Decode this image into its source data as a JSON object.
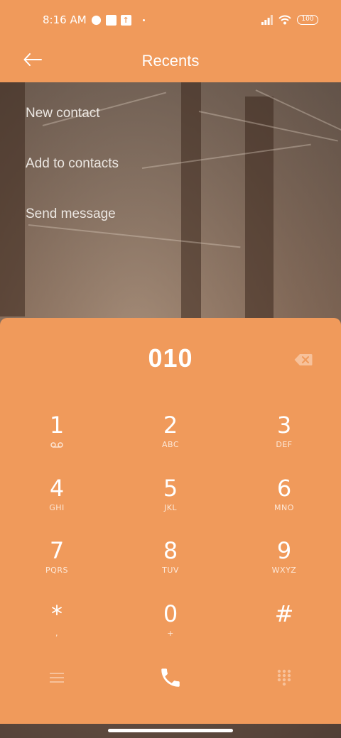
{
  "status_bar": {
    "time": "8:16 AM",
    "battery": "100",
    "icons": [
      "moon-icon",
      "square-notification-icon",
      "upload-icon",
      "dot-icon",
      "signal-icon",
      "wifi-icon",
      "battery-icon"
    ]
  },
  "app_bar": {
    "title": "Recents",
    "back_icon": "arrow-left-icon"
  },
  "menu": {
    "items": [
      {
        "label": "New contact"
      },
      {
        "label": "Add to contacts"
      },
      {
        "label": "Send message"
      }
    ]
  },
  "dialer": {
    "number": "010",
    "keys": [
      {
        "digit": "1",
        "letters": ""
      },
      {
        "digit": "2",
        "letters": "ABC"
      },
      {
        "digit": "3",
        "letters": "DEF"
      },
      {
        "digit": "4",
        "letters": "GHI"
      },
      {
        "digit": "5",
        "letters": "JKL"
      },
      {
        "digit": "6",
        "letters": "MNO"
      },
      {
        "digit": "7",
        "letters": "PQRS"
      },
      {
        "digit": "8",
        "letters": "TUV"
      },
      {
        "digit": "9",
        "letters": "WXYZ"
      },
      {
        "digit": "*",
        "letters": ","
      },
      {
        "digit": "0",
        "letters": "+"
      },
      {
        "digit": "#",
        "letters": ""
      }
    ],
    "actions": [
      "menu-icon",
      "phone-call-icon",
      "keypad-icon"
    ]
  },
  "colors": {
    "accent": "#f09a5b",
    "text": "#ffffff"
  }
}
